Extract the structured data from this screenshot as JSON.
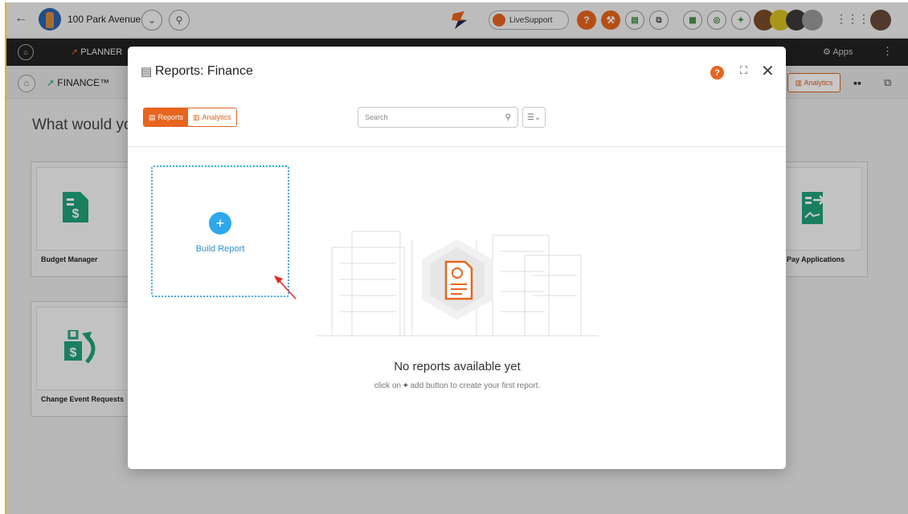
{
  "topbar": {
    "project_name": "100 Park Avenue",
    "live_support_label": "LiveSupport"
  },
  "nav": {
    "planner_label": "PLANNER",
    "apps_label": "Apps"
  },
  "subbar": {
    "module_title": "FINANCE™",
    "analytics_label": "Analytics"
  },
  "background": {
    "question": "What would yo",
    "cards": [
      {
        "label": "Budget Manager"
      },
      {
        "label": "Change Event Requests"
      },
      {
        "label": "ent Pay Applications"
      }
    ]
  },
  "modal": {
    "title": "Reports: Finance",
    "tabs": [
      {
        "label": "Reports",
        "active": true
      },
      {
        "label": "Analytics",
        "active": false
      }
    ],
    "search_placeholder": "Search",
    "build_report_label": "Build Report",
    "empty_title": "No reports available yet",
    "empty_prefix": "click on",
    "empty_plus": "+",
    "empty_suffix": "add button to create your first report."
  },
  "colors": {
    "accent_orange": "#e8651d",
    "accent_blue": "#2da8ea",
    "finance_green": "#1fa37a"
  }
}
